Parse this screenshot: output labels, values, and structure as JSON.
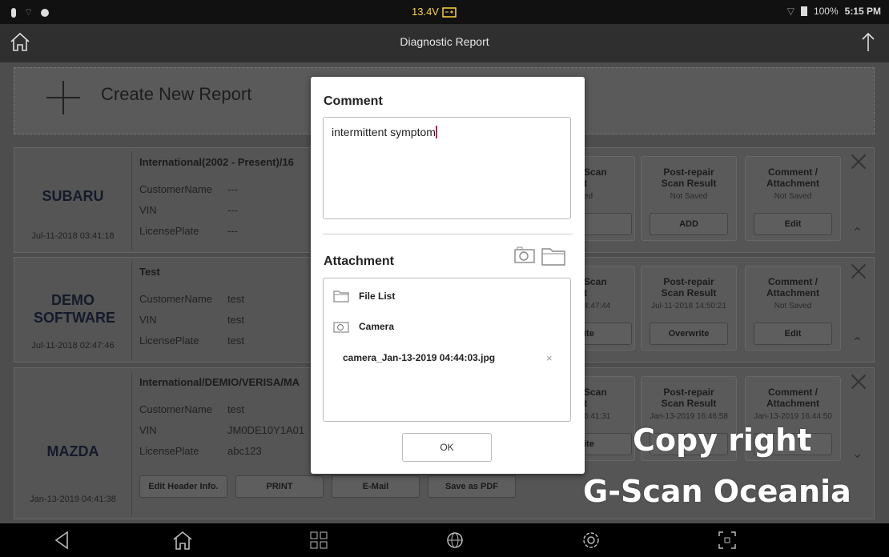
{
  "status_bar": {
    "voltage": "13.4V",
    "battery": "100%",
    "time": "5:15 PM"
  },
  "title_bar": {
    "title": "Diagnostic Report"
  },
  "create_new": {
    "label": "Create New Report"
  },
  "reports": [
    {
      "make": "SUBARU",
      "date": "Jul-11-2018 03:41:18",
      "header": "International(2002 - Present)/16",
      "customer_label": "CustomerName",
      "customer": "---",
      "vin_label": "VIN",
      "vin": "---",
      "plate_label": "LicensePlate",
      "plate": "---",
      "pre_scan": {
        "title_a": "Scan",
        "title_b": "t",
        "status": "ed"
      },
      "post_repair": {
        "title": "Post-repair Scan Result",
        "status": "Not Saved",
        "button": "ADD"
      },
      "comment": {
        "title": "Comment / Attachment",
        "status": "Not Saved",
        "button": "Edit"
      }
    },
    {
      "make": "DEMO SOFTWARE",
      "date": "Jul-11-2018 02:47:46",
      "header": "Test",
      "customer_label": "CustomerName",
      "customer": "test",
      "vin_label": "VIN",
      "vin": "test",
      "plate_label": "LicensePlate",
      "plate": "test",
      "pre_scan": {
        "title_a": "Scan",
        "title_b": "t",
        "status": "4:47:44",
        "button": "ite"
      },
      "post_repair": {
        "title": "Post-repair Scan Result",
        "status": "Jul-11-2018 14:50:21",
        "button": "Overwrite"
      },
      "comment": {
        "title": "Comment / Attachment",
        "status": "Not Saved",
        "button": "Edit"
      }
    },
    {
      "make": "MAZDA",
      "date": "Jan-13-2019 04:41:38",
      "header": "International/DEMIO/VERISA/MA",
      "customer_label": "CustomerName",
      "customer": "test",
      "vin_label": "VIN",
      "vin": "JM0DE10Y1A01",
      "plate_label": "LicensePlate",
      "plate": "abc123",
      "pre_scan": {
        "title_a": "Scan",
        "title_b": "t",
        "status": "6:41:31",
        "button": "ite"
      },
      "post_repair": {
        "title": "Post-repair Scan Result",
        "status": "Jan-13-2019 16:46:58"
      },
      "comment": {
        "title": "Comment / Attachment",
        "status": "Jan-13-2019 16:44:50"
      },
      "actions": [
        "Edit Header Info.",
        "PRINT",
        "E-Mail",
        "Save as PDF"
      ]
    }
  ],
  "modal": {
    "comment_heading": "Comment",
    "comment_value": "intermittent symptom",
    "attachment_heading": "Attachment",
    "file_list_label": "File List",
    "camera_label": "Camera",
    "file_name": "camera_Jan-13-2019 04:44:03.jpg",
    "ok_label": "OK"
  },
  "watermark": {
    "line1": "Copy right",
    "line2": "G-Scan Oceania"
  }
}
